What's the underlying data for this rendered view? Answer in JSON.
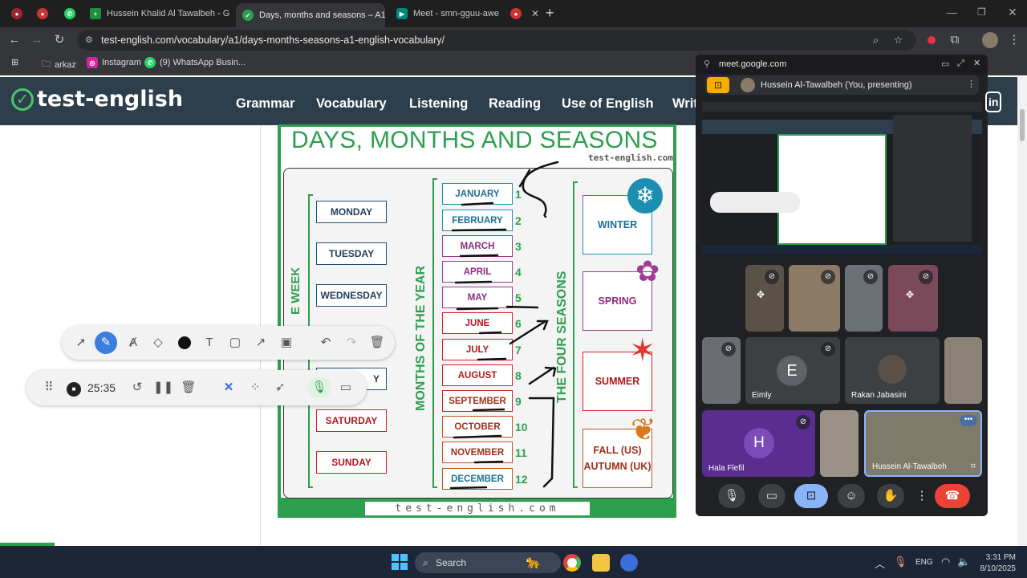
{
  "browser": {
    "tabs": [
      {
        "title": "",
        "active": false
      },
      {
        "title": "",
        "active": false
      },
      {
        "title": "Hussein Khalid Al Tawalbeh - G",
        "active": false
      },
      {
        "title": "Days, months and seasons – A1",
        "active": true
      },
      {
        "title": "Meet - smn-gguu-awe",
        "active": false
      },
      {
        "title": "",
        "active": false
      }
    ],
    "new_tab": "+",
    "url": "test-english.com/vocabulary/a1/days-months-seasons-a1-english-vocabulary/",
    "bookmarks": [
      "arkaz",
      "Instagram",
      "(9) WhatsApp Busin..."
    ]
  },
  "site": {
    "logo": "test-english",
    "nav": [
      "Grammar",
      "Vocabulary",
      "Listening",
      "Reading",
      "Use of English",
      "Writ"
    ],
    "login": "in"
  },
  "worksheet": {
    "title": "DAYS, MONTHS AND SEASONS",
    "watermark_top": "test-english.com",
    "week_label": "E WEEK",
    "months_label": "MONTHS OF THE YEAR",
    "seasons_label": "THE FOUR SEASONS",
    "days": [
      "MONDAY",
      "TUESDAY",
      "WEDNESDAY",
      "Y",
      "SATURDAY",
      "SUNDAY"
    ],
    "months": [
      "JANUARY",
      "FEBRUARY",
      "MARCH",
      "APRIL",
      "MAY",
      "JUNE",
      "JULY",
      "AUGUST",
      "SEPTEMBER",
      "OCTOBER",
      "NOVEMBER",
      "DECEMBER"
    ],
    "month_numbers": [
      "1",
      "2",
      "3",
      "4",
      "5",
      "6",
      "7",
      "8",
      "9",
      "10",
      "11",
      "12"
    ],
    "seasons": [
      "WINTER",
      "SPRING",
      "SUMMER",
      "FALL (US)\nAUTUMN (UK)"
    ],
    "footer": "test-english.com",
    "colors": {
      "green": "#2e9f4f",
      "blue": "#1f4e79",
      "purple": "#9b3a8e",
      "red": "#d4202a",
      "teal": "#1c8fb0"
    }
  },
  "recorder": {
    "time": "25:35"
  },
  "meet": {
    "host": "meet.google.com",
    "presenting": "Hussein Al-Tawalbeh (You, presenting)",
    "participants": [
      {
        "name": ""
      },
      {
        "name": ""
      },
      {
        "name": ""
      },
      {
        "name": ""
      },
      {
        "name": ""
      },
      {
        "name": "Eimly",
        "initial": "E"
      },
      {
        "name": "Rakan Jabasini"
      },
      {
        "name": ""
      },
      {
        "name": "Hala Flefil",
        "initial": "H"
      },
      {
        "name": ""
      },
      {
        "name": "Hussein Al-Tawalbeh"
      }
    ]
  },
  "taskbar": {
    "search": "Search",
    "language": "ENG",
    "time": "3:31 PM",
    "date": "8/10/2025"
  }
}
